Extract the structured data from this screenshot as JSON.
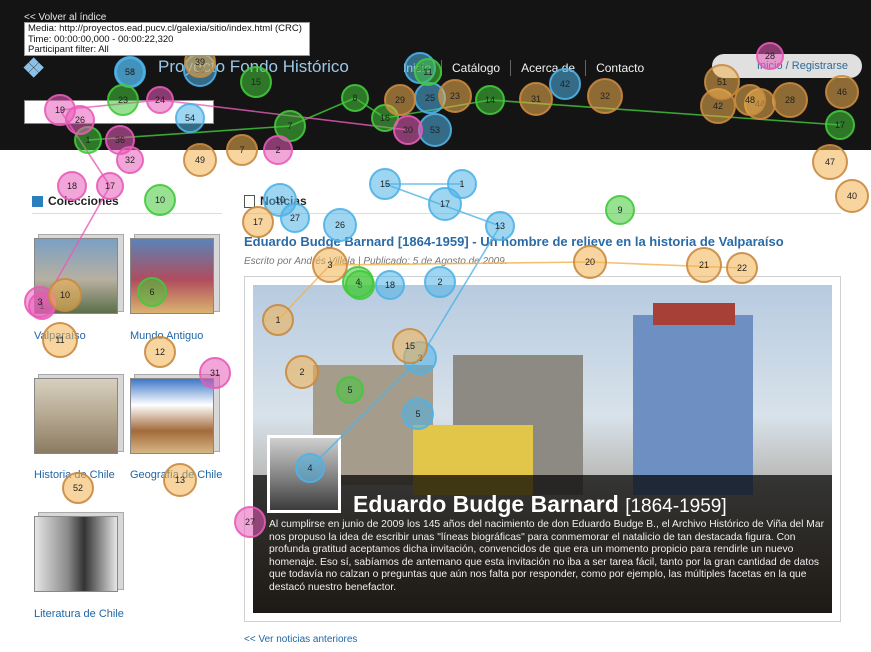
{
  "overlay": {
    "back_link": "<< Volver al índice",
    "media_line": "Media: http://proyectos.ead.pucv.cl/galexia/sitio/index.html (CRC)",
    "time_line": "Time: 00:00:00,000 - 00:00:22,320",
    "filter_line": "Participant filter: All"
  },
  "header": {
    "site_title": "Proyecto Fondo Histórico",
    "nav": [
      "Inicio",
      "Catálogo",
      "Acerca de",
      "Contacto"
    ],
    "login": "Inicio / Registrarse"
  },
  "colecciones": {
    "title": "Colecciones",
    "items": [
      {
        "label": "Valparaíso",
        "colors": [
          "#7aa0c4",
          "#b8b0a0",
          "#5c6e4a"
        ]
      },
      {
        "label": "Mundo Antiguo",
        "colors": [
          "#5a83b8",
          "#b04d5d",
          "#d9b36e"
        ]
      },
      {
        "label": "Historia de Chile",
        "colors": [
          "#b5a890",
          "#8c7b62",
          "#d7cfbf"
        ]
      },
      {
        "label": "Geografía de Chile",
        "colors": [
          "#3d77c9",
          "#ffffff",
          "#a26a3a"
        ]
      },
      {
        "label": "Literatura de Chile",
        "colors": [
          "#e5e5e5",
          "#333333",
          "#8a8a8a"
        ]
      }
    ]
  },
  "noticias": {
    "title": "Noticias",
    "headline": "Eduardo Budge Barnard [1864-1959] - Un hombre de relieve en la historia de Valparaíso",
    "byline": "Escrito por Andrés Villela | Publicado: 5 de Agosto de 2009.",
    "feature_name": "Eduardo Budge Barnard",
    "feature_years": "[1864-1959]",
    "feature_text": "Al cumplirse en junio de 2009 los 145 años del nacimiento de don Eduardo Budge B., el Archivo Histórico de Viña del Mar nos propuso la idea de escribir unas \"líneas biográficas\" para conmemorar el natalicio de tan destacada figura. Con profunda gratitud aceptamos dicha invitación, convencidos de que era un momento propicio para rendirle un nuevo homenaje. Eso sí, sabíamos de antemano que esta invitación no iba a ser tarea fácil, tanto por la gran cantidad de datos que todavía no calzan o preguntas que aún nos falta por responder, como por ejemplo, las múltiples facetas en la que destacó nuestro benefactor.",
    "more_link": "<< Ver noticias anteriores"
  },
  "gaze_colors": {
    "blue": "#4fb3e6",
    "green": "#43c93b",
    "pink": "#e85bb8",
    "orange": "#f3b14e",
    "brown": "#c98a3f"
  },
  "gaze_labels": {
    "blue": [
      "1",
      "2",
      "3",
      "4",
      "5",
      "10",
      "13",
      "15",
      "17",
      "18",
      "25",
      "26",
      "27",
      "29",
      "30",
      "31",
      "42",
      "53",
      "54",
      "58"
    ],
    "green": [
      "1",
      "3",
      "4",
      "5",
      "6",
      "7",
      "8",
      "9",
      "10",
      "11",
      "14",
      "15",
      "16",
      "17",
      "23"
    ],
    "pink": [
      "1",
      "2",
      "3",
      "17",
      "18",
      "19",
      "24",
      "26",
      "27",
      "28",
      "30",
      "31",
      "32",
      "36"
    ],
    "orange": [
      "1",
      "2",
      "3",
      "7",
      "10",
      "11",
      "12",
      "13",
      "15",
      "17",
      "20",
      "21",
      "22",
      "23",
      "28",
      "29",
      "31",
      "32",
      "39",
      "40",
      "42",
      "44",
      "46",
      "47",
      "48",
      "49",
      "51",
      "52"
    ]
  }
}
